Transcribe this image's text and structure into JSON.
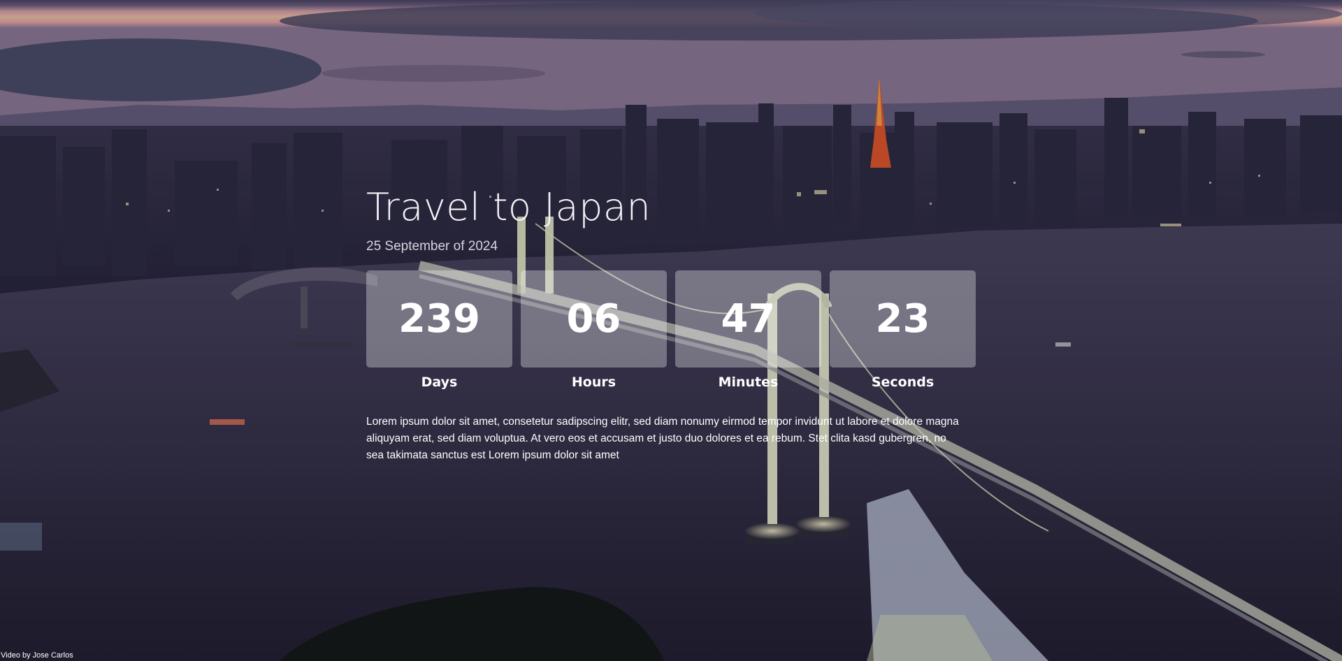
{
  "hero": {
    "title": "Travel to Japan",
    "date": "25 September of 2024"
  },
  "countdown": [
    {
      "value": "239",
      "label": "Days"
    },
    {
      "value": "06",
      "label": "Hours"
    },
    {
      "value": "47",
      "label": "Minutes"
    },
    {
      "value": "23",
      "label": "Seconds"
    }
  ],
  "description": "Lorem ipsum dolor sit amet, consetetur sadipscing elitr, sed diam nonumy eirmod tempor invidunt ut labore et dolore magna aliquyam erat, sed diam voluptua. At vero eos et accusam et justo duo dolores et ea rebum. Stet clita kasd gubergren, no sea takimata sanctus est Lorem ipsum dolor sit amet",
  "credit": "Video by Jose Carlos",
  "colors": {
    "text": "#ffffff",
    "box_bg": "rgba(255,255,255,0.32)",
    "sky_top": "#5a4f72",
    "sky_glow": "#f3b9a4",
    "water": "#3a3550"
  }
}
